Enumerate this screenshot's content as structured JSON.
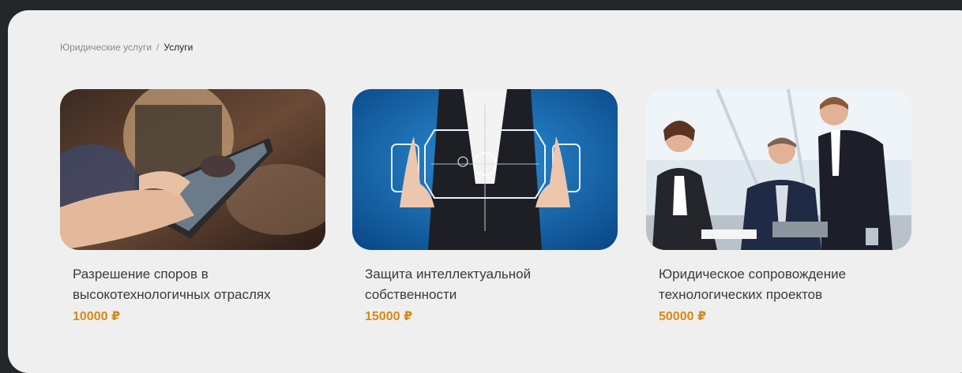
{
  "breadcrumb": {
    "home": "Юридические услуги",
    "separator": "/",
    "current": "Услуги"
  },
  "cards": [
    {
      "title": "Разрешение споров в высокотехнологичных отраслях",
      "price": "10000 ₽",
      "image": "tablet-meeting-photo"
    },
    {
      "title": "Защита интеллектуальной собственности",
      "price": "15000 ₽",
      "image": "business-hologram-photo"
    },
    {
      "title": "Юридическое сопровождение технологических проектов",
      "price": "50000 ₽",
      "image": "office-team-photo"
    }
  ],
  "colors": {
    "background": "#24272a",
    "panel": "#efefef",
    "price": "#d78a16"
  }
}
